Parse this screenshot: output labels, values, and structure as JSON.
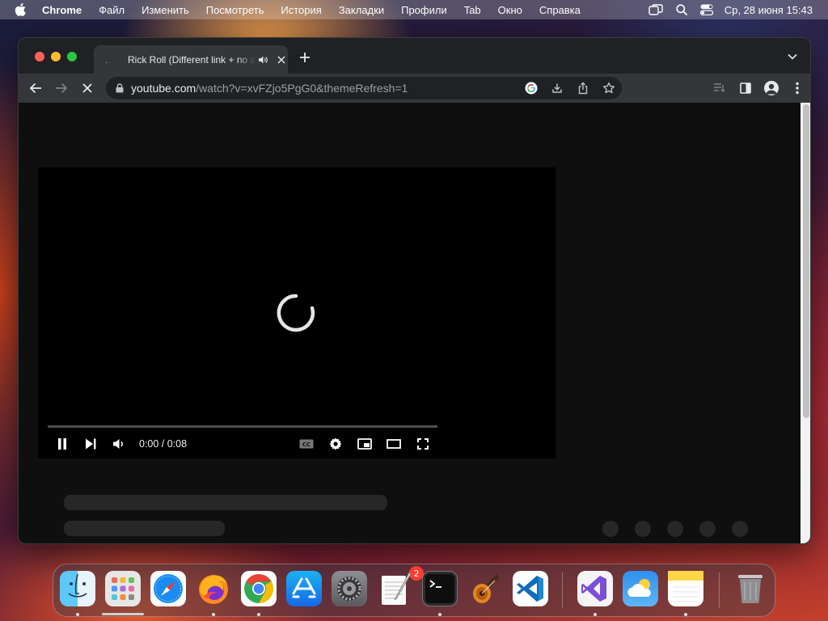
{
  "menubar": {
    "app_name": "Chrome",
    "items": [
      "Файл",
      "Изменить",
      "Посмотреть",
      "История",
      "Закладки",
      "Профили",
      "Tab",
      "Окно",
      "Справка"
    ],
    "clock": "Ср, 28 июня  15:43"
  },
  "tab": {
    "title": "Rick Roll (Different link + no ads)",
    "favicon": "loading-indicator-icon",
    "audio": "speaker-icon"
  },
  "address_bar": {
    "host": "youtube.com",
    "path": "/watch?v=xvFZjo5PgG0&themeRefresh=1"
  },
  "player": {
    "time": "0:00 / 0:08",
    "state": "loading",
    "progress_fraction": 0
  },
  "dock": {
    "apps": [
      "Finder",
      "Launchpad",
      "Safari",
      "Firefox",
      "Google Chrome",
      "App Store",
      "System Settings",
      "TextEdit",
      "Terminal",
      "GarageBand",
      "Visual Studio Code",
      "Visual Studio",
      "Weather",
      "Notes",
      "Trash"
    ],
    "system_settings_badge": "2"
  },
  "colors": {
    "youtube_bg": "#0f0f0f",
    "chrome_dark": "#202124",
    "toolbar": "#35363a"
  }
}
